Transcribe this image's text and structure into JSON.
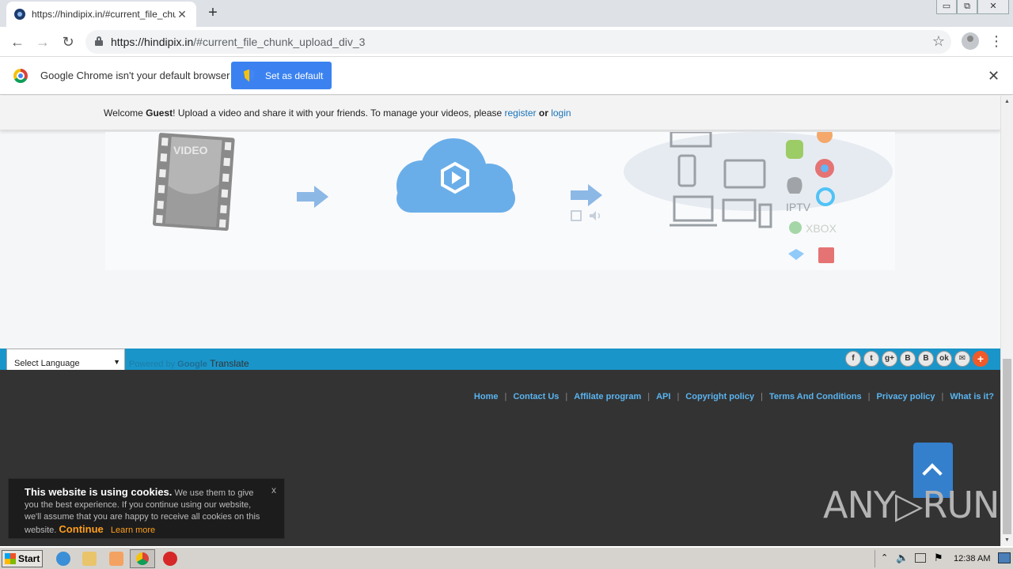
{
  "browser": {
    "tab_title": "https://hindipix.in/#current_file_chu",
    "tab_close": "✕",
    "new_tab": "+",
    "url_host": "https://hindipix.in",
    "url_path": "/#current_file_chunk_upload_div_3",
    "window_controls": [
      "▭",
      "⧉",
      "✕"
    ]
  },
  "infobar": {
    "message": "Google Chrome isn't your default browser",
    "button": "Set as default",
    "close": "✕"
  },
  "welcome": {
    "prefix": "Welcome ",
    "user": "Guest",
    "text": "! Upload a video and share it with your friends. To manage your videos, please ",
    "register": "register",
    "or": " or ",
    "login": "login"
  },
  "hero": {
    "film_label": "VIDEO",
    "device_labels": [
      "IPTV",
      "XBOX"
    ]
  },
  "translate": {
    "select_label": "Select Language",
    "powered_by": "Powered by ",
    "google": "Google",
    "translate": "Translate"
  },
  "social": [
    "f",
    "t",
    "g+",
    "B",
    "B",
    "ok",
    "✉",
    "+"
  ],
  "footer": {
    "links": [
      "Home",
      "Contact Us",
      "Affilate program",
      "API",
      "Copyright policy",
      "Terms And Conditions",
      "Privacy policy",
      "What is it?"
    ]
  },
  "cookie": {
    "title": "This website is using cookies.",
    "body": " We use them to give you the best experience. If you continue using our website, we'll assume that you are happy to receive all cookies on this website.",
    "continue": "Continue",
    "learn_more": "Learn more",
    "close": "x"
  },
  "watermark": "ANY▷RUN",
  "taskbar": {
    "start": "Start",
    "clock": "12:38 AM"
  }
}
